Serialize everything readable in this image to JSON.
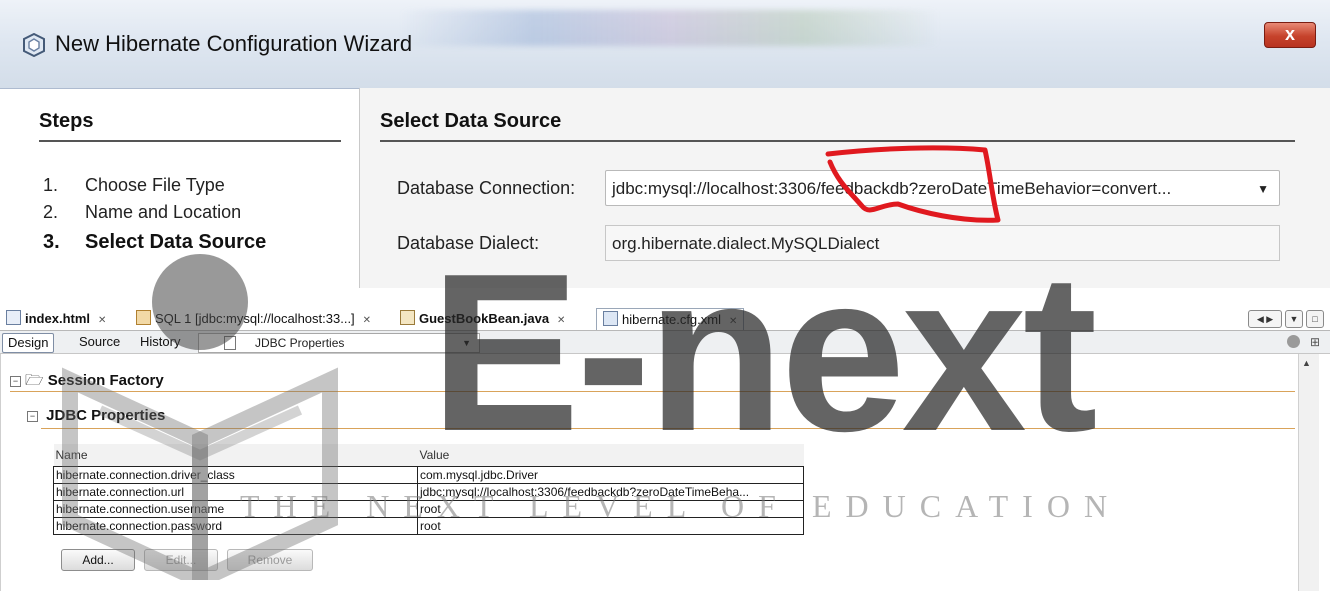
{
  "wizard": {
    "title": "New Hibernate Configuration Wizard",
    "close_label": "x",
    "steps_heading": "Steps",
    "steps": [
      {
        "num": "1.",
        "label": "Choose File Type",
        "current": false
      },
      {
        "num": "2.",
        "label": "Name and Location",
        "current": false
      },
      {
        "num": "3.",
        "label": "Select Data Source",
        "current": true
      }
    ],
    "panel_heading": "Select Data Source",
    "db_connection_label": "Database Connection:",
    "db_connection_value": "jdbc:mysql://localhost:3306/feedbackdb?zeroDateTimeBehavior=convert...",
    "db_dialect_label": "Database Dialect:",
    "db_dialect_value": "org.hibernate.dialect.MySQLDialect"
  },
  "editor": {
    "tabs": [
      {
        "label": "index.html",
        "bold": true,
        "active": false
      },
      {
        "label": "SQL 1 [jdbc:mysql://localhost:33...]",
        "bold": false,
        "active": false
      },
      {
        "label": "GuestBookBean.java",
        "bold": true,
        "active": false
      },
      {
        "label": "hibernate.cfg.xml",
        "bold": false,
        "active": true
      }
    ],
    "views": [
      "Design",
      "Source",
      "History"
    ],
    "active_view": "Design",
    "section_combo": "JDBC Properties",
    "session_factory_label": "Session Factory",
    "jdbc_section_label": "JDBC Properties",
    "columns": [
      "Name",
      "Value"
    ],
    "rows": [
      {
        "name": "hibernate.connection.driver_class",
        "value": "com.mysql.jdbc.Driver"
      },
      {
        "name": "hibernate.connection.url",
        "value": "jdbc:mysql://localhost:3306/feedbackdb?zeroDateTimeBeha..."
      },
      {
        "name": "hibernate.connection.username",
        "value": "root"
      },
      {
        "name": "hibernate.connection.password",
        "value": "root"
      }
    ],
    "buttons": {
      "add": "Add...",
      "edit": "Edit...",
      "remove": "Remove"
    }
  },
  "watermark": {
    "brand": "E-next",
    "tagline": "THE NEXT LEVEL OF EDUCATION"
  },
  "colors": {
    "annotation_red": "#e0191f",
    "section_rule": "#d9a35a",
    "close_button": "#c6432c"
  }
}
